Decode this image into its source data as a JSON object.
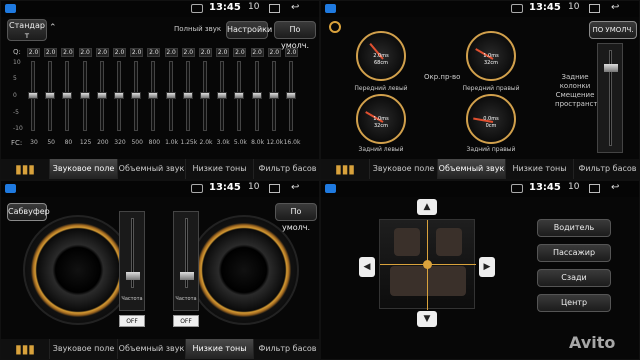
{
  "status": {
    "time": "13:45",
    "volume": "10"
  },
  "tabs": [
    "Звуковое поле",
    "Объемный звук",
    "Низкие тоны",
    "Фильтр басов"
  ],
  "eq": {
    "preset": "Стандар т",
    "header": "Полный звук",
    "settings_btn": "Настройки",
    "default_btn": "По умолч.",
    "q_label": "Q:",
    "fc_label": "FC:",
    "scale": [
      "10",
      "5",
      "0",
      "-5",
      "-10"
    ],
    "bands": [
      {
        "q": "2.0",
        "fc": "30"
      },
      {
        "q": "2.0",
        "fc": "50"
      },
      {
        "q": "2.0",
        "fc": "80"
      },
      {
        "q": "2.0",
        "fc": "125"
      },
      {
        "q": "2.0",
        "fc": "200"
      },
      {
        "q": "2.0",
        "fc": "320"
      },
      {
        "q": "2.0",
        "fc": "500"
      },
      {
        "q": "2.0",
        "fc": "800"
      },
      {
        "q": "2.0",
        "fc": "1.0k"
      },
      {
        "q": "2.0",
        "fc": "1.25k"
      },
      {
        "q": "2.0",
        "fc": "2.0k"
      },
      {
        "q": "2.0",
        "fc": "3.0k"
      },
      {
        "q": "2.0",
        "fc": "5.0k"
      },
      {
        "q": "2.0",
        "fc": "8.0k"
      },
      {
        "q": "2.0",
        "fc": "12.0k"
      },
      {
        "q": "2.0",
        "fc": "16.0k"
      }
    ]
  },
  "delay": {
    "default_btn": "ПО УМОЛЧ.",
    "center_label": "Окр.пр-во",
    "side_label": "Задние колонки Смещение пространства",
    "gauges": [
      {
        "ms": "2.0ms",
        "cm": "68cm",
        "label": "Передний левый"
      },
      {
        "ms": "1.0ms",
        "cm": "32cm",
        "label": "Передний правый"
      },
      {
        "ms": "1.0ms",
        "cm": "32cm",
        "label": "Задний левый"
      },
      {
        "ms": "0.0ms",
        "cm": "0cm",
        "label": "Задний правый"
      }
    ]
  },
  "sub": {
    "title_btn": "Сабвуфер",
    "default_btn": "По умолч.",
    "sliders": [
      {
        "label": "Частота",
        "off": "OFF"
      },
      {
        "label": "Частота",
        "off": "OFF"
      }
    ]
  },
  "balance": {
    "buttons": [
      "Водитель",
      "Пассажир",
      "Сзади",
      "Центр"
    ],
    "up": "▲",
    "down": "▼",
    "left": "◀",
    "right": "▶"
  },
  "watermark": "Avito"
}
